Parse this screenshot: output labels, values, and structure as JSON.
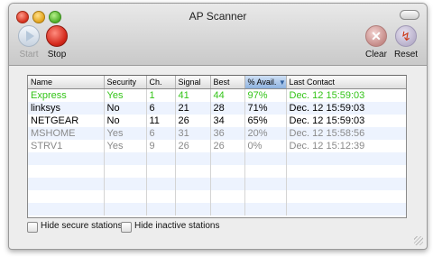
{
  "window": {
    "title": "AP Scanner"
  },
  "toolbar": {
    "start_label": "Start",
    "stop_label": "Stop",
    "clear_label": "Clear",
    "reset_label": "Reset",
    "start_enabled": false
  },
  "table": {
    "columns": [
      "Name",
      "Security",
      "Ch.",
      "Signal",
      "Best",
      "% Avail.",
      "Last Contact"
    ],
    "sorted_column": "% Avail.",
    "sort_direction": "descending",
    "rows": [
      {
        "cells": [
          "Express",
          "Yes",
          "1",
          "41",
          "44",
          "97%",
          "Dec. 12 15:59:03"
        ],
        "color": "#34c419"
      },
      {
        "cells": [
          "linksys",
          "No",
          "6",
          "21",
          "28",
          "71%",
          "Dec. 12 15:59:03"
        ],
        "color": "#000000"
      },
      {
        "cells": [
          "NETGEAR",
          "No",
          "11",
          "26",
          "34",
          "65%",
          "Dec. 12 15:59:03"
        ],
        "color": "#000000"
      },
      {
        "cells": [
          "MSHOME",
          "Yes",
          "6",
          "31",
          "36",
          "20%",
          "Dec. 12 15:58:56"
        ],
        "color": "#8a8a8a"
      },
      {
        "cells": [
          "STRV1",
          "Yes",
          "9",
          "26",
          "26",
          "0%",
          "Dec. 12 15:12:39"
        ],
        "color": "#8a8a8a"
      }
    ]
  },
  "options": {
    "hide_secure_label": "Hide secure stations",
    "hide_secure_checked": false,
    "hide_inactive_label": "Hide inactive stations",
    "hide_inactive_checked": false
  },
  "icons": {
    "start": "play-icon",
    "stop": "stop-icon",
    "clear": "clear-icon",
    "reset": "reset-icon"
  },
  "colors": {
    "active_strong": "#34c419",
    "active": "#000000",
    "inactive": "#8a8a8a",
    "alt_row": "#edf3fe",
    "sorted_header": "#8fb3e0"
  }
}
